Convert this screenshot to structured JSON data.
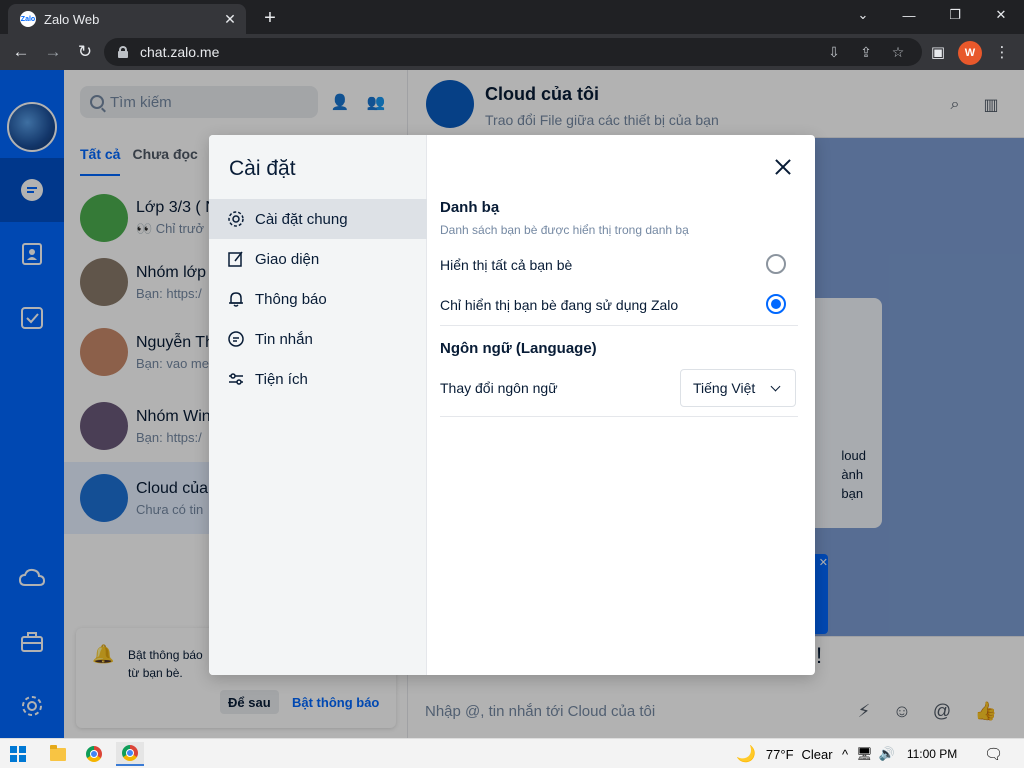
{
  "browser": {
    "tab_title": "Zalo Web",
    "tab_favicon_text": "Zalo",
    "url": "chat.zalo.me",
    "profile_initial": "W"
  },
  "zalo": {
    "search_placeholder": "Tìm kiếm",
    "filters": [
      "Tất cả",
      "Chưa đọc"
    ],
    "conversations": [
      {
        "name": "Lớp 3/3 ( N",
        "preview": "👀 Chỉ trưở"
      },
      {
        "name": "Nhóm lớp",
        "preview": "Bạn: https:/"
      },
      {
        "name": "Nguyễn Th",
        "preview": "Bạn: vao me"
      },
      {
        "name": "Nhóm Win",
        "preview": "Bạn: https:/"
      },
      {
        "name": "Cloud của",
        "preview": "Chưa có tin"
      }
    ],
    "notification": {
      "text_line1": "Bật thông báo",
      "text_line2": "từ bạn bè.",
      "later_label": "Để sau",
      "enable_label": "Bật thông báo"
    },
    "chat": {
      "title": "Cloud của tôi",
      "subtitle": "Trao đổi File giữa các thiết bị của bạn",
      "card_line1": "loud",
      "card_line2": "ành",
      "card_line3": "bạn",
      "input_placeholder": "Nhập @, tin nhắn tới Cloud của tôi",
      "excl": "!"
    }
  },
  "settings": {
    "title": "Cài đặt",
    "menu": [
      {
        "label": "Cài đặt chung",
        "icon": "gear-icon"
      },
      {
        "label": "Giao diện",
        "icon": "edit-icon"
      },
      {
        "label": "Thông báo",
        "icon": "bell-icon"
      },
      {
        "label": "Tin nhắn",
        "icon": "message-icon"
      },
      {
        "label": "Tiện ích",
        "icon": "sliders-icon"
      }
    ],
    "contacts_title": "Danh bạ",
    "contacts_desc": "Danh sách bạn bè được hiển thị trong danh bạ",
    "option_all": "Hiển thị tất cả bạn bè",
    "option_zalo": "Chỉ hiển thị bạn bè đang sử dụng Zalo",
    "selected_option": "option_zalo",
    "language_title": "Ngôn ngữ (Language)",
    "language_label": "Thay đổi ngôn ngữ",
    "language_value": "Tiếng Việt"
  },
  "taskbar": {
    "weather_temp": "77°F",
    "weather_text": "Clear",
    "time": "11:00 PM"
  },
  "colors": {
    "zalo_blue": "#0068ff",
    "chrome_dark": "#202124"
  }
}
